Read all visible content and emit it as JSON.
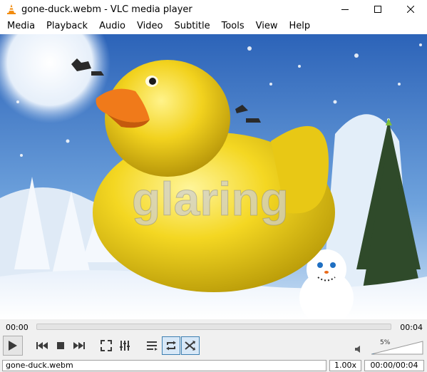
{
  "window": {
    "title": "gone-duck.webm - VLC media player"
  },
  "menu": [
    "Media",
    "Playback",
    "Audio",
    "Video",
    "Subtitle",
    "Tools",
    "View",
    "Help"
  ],
  "video": {
    "overlay_text": "glaring"
  },
  "seek": {
    "elapsed": "00:00",
    "total": "00:04",
    "progress": 0
  },
  "volume": {
    "percent_label": "5%",
    "level": 0.05
  },
  "status": {
    "filename": "gone-duck.webm",
    "speed": "1.00x",
    "time": "00:00/00:04"
  },
  "colors": {
    "accent": "#3c7fb1",
    "duck": "#f2d21e",
    "beak": "#f07a1a"
  },
  "icons": [
    "vlc-cone-icon",
    "minimize-icon",
    "maximize-icon",
    "close-icon",
    "play-icon",
    "previous-icon",
    "stop-icon",
    "next-icon",
    "fullscreen-icon",
    "extended-settings-icon",
    "playlist-icon",
    "loop-icon",
    "shuffle-icon",
    "speaker-icon"
  ]
}
